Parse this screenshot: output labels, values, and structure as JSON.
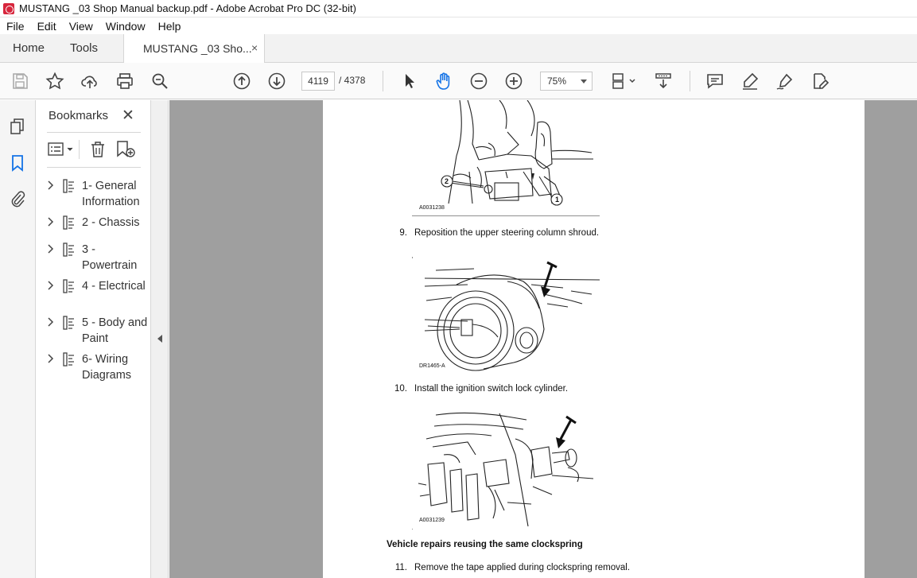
{
  "window": {
    "title": "MUSTANG _03 Shop Manual backup.pdf - Adobe Acrobat Pro DC (32-bit)"
  },
  "menu": [
    "File",
    "Edit",
    "View",
    "Window",
    "Help"
  ],
  "tabs": {
    "home": "Home",
    "tools": "Tools",
    "document": "MUSTANG _03 Sho...",
    "close": "×"
  },
  "toolbar": {
    "page_current": "4119",
    "page_total": "/ 4378",
    "zoom": "75%"
  },
  "bookmarks": {
    "title": "Bookmarks",
    "close": "✕",
    "items": [
      {
        "label": "1- General Information"
      },
      {
        "label": "2 - Chassis"
      },
      {
        "label": "3 - Powertrain"
      },
      {
        "label": "4 - Electrical"
      },
      {
        "label": "5 - Body and Paint"
      },
      {
        "label": "6- Wiring Diagrams"
      }
    ]
  },
  "document": {
    "figure1": {
      "code": "A0031238",
      "callout1": "1",
      "callout2": "2"
    },
    "step9": {
      "num": "9.",
      "text": "Reposition the upper steering column shroud."
    },
    "figure2": {
      "code": "DR1465-A"
    },
    "step10": {
      "num": "10.",
      "text": "Install the ignition switch lock cylinder."
    },
    "figure3": {
      "code": "A0031239"
    },
    "heading": "Vehicle repairs reusing the same clockspring",
    "step11": {
      "num": "11.",
      "text": "Remove the tape applied during clockspring removal."
    }
  }
}
